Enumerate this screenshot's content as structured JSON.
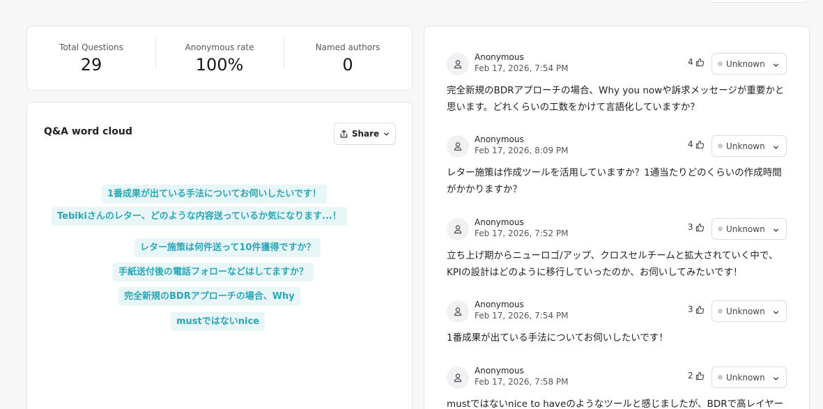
{
  "stats": [
    {
      "label": "Total Questions",
      "value": "29"
    },
    {
      "label": "Anonymous rate",
      "value": "100%"
    },
    {
      "label": "Named authors",
      "value": "0"
    }
  ],
  "cloud": {
    "title": "Q&A word cloud",
    "share_label": "Share",
    "phrases": [
      "1番成果が出ている手法についてお伺いしたいです！",
      "Tebikiさんのレター、どのような内容送っているか気になります...！",
      "レター施策は何件送って10件獲得ですか？",
      "手紙送付後の電話フォローなどはしてますか？",
      "完全新規のBDRアプローチの場合、Why",
      "mustではないnice"
    ]
  },
  "questions": [
    {
      "author": "Anonymous",
      "date": "Feb 17, 2026, 7:54 PM",
      "votes": "4",
      "status": "Unknown",
      "text": "完全新規のBDRアプローチの場合、Why you nowや訴求メッセージが重要かと思います。どれくらいの工数をかけて言語化していますか？"
    },
    {
      "author": "Anonymous",
      "date": "Feb 17, 2026, 8:09 PM",
      "votes": "4",
      "status": "Unknown",
      "text": "レター施策は作成ツールを活用していますか？1通当たりどのくらいの作成時間がかかりますか？"
    },
    {
      "author": "Anonymous",
      "date": "Feb 17, 2026, 7:52 PM",
      "votes": "3",
      "status": "Unknown",
      "text": "立ち上げ期からニューロゴ/アップ、クロスセルチームと拡大されていく中で、KPIの設計はどのように移行していったのか、お伺いしてみたいです！"
    },
    {
      "author": "Anonymous",
      "date": "Feb 17, 2026, 7:54 PM",
      "votes": "3",
      "status": "Unknown",
      "text": "1番成果が出ている手法についてお伺いしたいです！"
    },
    {
      "author": "Anonymous",
      "date": "Feb 17, 2026, 7:58 PM",
      "votes": "2",
      "status": "Unknown",
      "text": "mustではないnice to haveのようなツールと感じましたが、BDRで高レイヤー"
    }
  ],
  "colors": {
    "accent": "#2aa6b6",
    "chip_bg": "#e8f6f8"
  }
}
